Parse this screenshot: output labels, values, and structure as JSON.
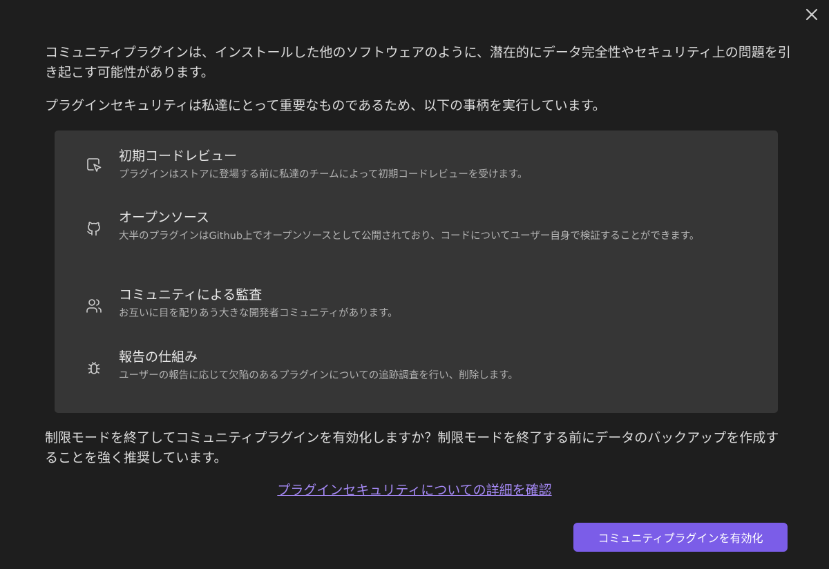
{
  "dialog": {
    "close_icon": "close-icon",
    "intro_paragraph_1": "コミュニティプラグインは、インストールした他のソフトウェアのように、潜在的にデータ完全性やセキュリティ上の問題を引き起こす可能性があります。",
    "intro_paragraph_2": "プラグインセキュリティは私達にとって重要なものであるため、以下の事柄を実行しています。",
    "features": [
      {
        "icon": "cursor-click-icon",
        "title": "初期コードレビュー",
        "description": "プラグインはストアに登場する前に私達のチームによって初期コードレビューを受けます。"
      },
      {
        "icon": "github-icon",
        "title": "オープンソース",
        "description": "大半のプラグインはGithub上でオープンソースとして公開されており、コードについてユーザー自身で検証することができます。"
      },
      {
        "icon": "users-icon",
        "title": "コミュニティによる監査",
        "description": "お互いに目を配りあう大きな開発者コミュニティがあります。"
      },
      {
        "icon": "bug-icon",
        "title": "報告の仕組み",
        "description": "ユーザーの報告に応じて欠陥のあるプラグインについての追跡調査を行い、削除します。"
      }
    ],
    "confirm_text": "制限モードを終了してコミュニティプラグインを有効化しますか？制限モードを終了する前にデータのバックアップを作成することを強く推奨しています。",
    "learn_more_link": "プラグインセキュリティについての詳細を確認",
    "enable_button": "コミュニティプラグインを有効化"
  },
  "colors": {
    "background": "#1e1e1e",
    "panel": "#363636",
    "accent": "#7b5de8",
    "link": "#a68af7"
  }
}
